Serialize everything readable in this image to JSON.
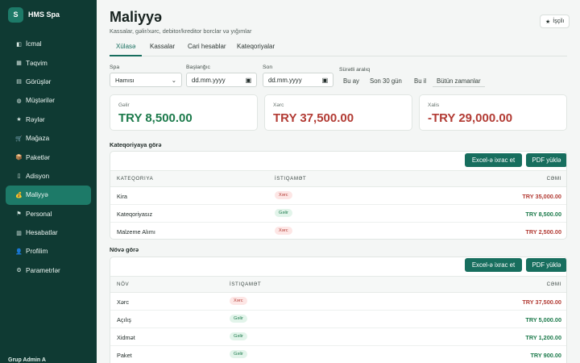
{
  "app": {
    "logo_letter": "S",
    "name": "HMS Spa"
  },
  "sidebar": {
    "items": [
      {
        "label": "İcmal",
        "icon": "dashboard-icon",
        "glyph": "◧"
      },
      {
        "label": "Təqvim",
        "icon": "calendar-icon",
        "glyph": "▦"
      },
      {
        "label": "Görüşlər",
        "icon": "appointments-icon",
        "glyph": "▤"
      },
      {
        "label": "Müştərilər",
        "icon": "clients-icon",
        "glyph": "◍"
      },
      {
        "label": "Rəylər",
        "icon": "star-icon",
        "glyph": "★"
      },
      {
        "label": "Mağaza",
        "icon": "shop-icon",
        "glyph": "🛒"
      },
      {
        "label": "Paketlər",
        "icon": "package-icon",
        "glyph": "📦"
      },
      {
        "label": "Adisyon",
        "icon": "receipt-icon",
        "glyph": "▯"
      },
      {
        "label": "Maliyyə",
        "icon": "finance-icon",
        "glyph": "💰"
      },
      {
        "label": "Personal",
        "icon": "flag-icon",
        "glyph": "⚑"
      },
      {
        "label": "Hesabatlar",
        "icon": "reports-icon",
        "glyph": "▥"
      },
      {
        "label": "Profilim",
        "icon": "profile-icon",
        "glyph": "👤"
      },
      {
        "label": "Parametrlər",
        "icon": "settings-icon",
        "glyph": "⚙"
      }
    ],
    "active_index": 8,
    "footer_user": "Grup Admin A"
  },
  "header": {
    "title": "Maliyyə",
    "subtitle": "Kassalar, gəlir/xərc, debitor/kreditor borclar və yığımlar",
    "role_badge": "İşçilı",
    "role_icon": "★"
  },
  "tabs": [
    "Xülasə",
    "Kassalar",
    "Cari hesablar",
    "Kateqoriyalar"
  ],
  "filters": {
    "spa_label": "Spa",
    "spa_value": "Hamısı",
    "start_label": "Başlanğıc",
    "start_value": "dd.mm.yyyy",
    "end_label": "Son",
    "end_value": "dd.mm.yyyy",
    "quick_label": "Sürətli aralıq",
    "quick_options": [
      "Bu ay",
      "Son 30 gün",
      "Bu il",
      "Bütün zamanlar"
    ]
  },
  "summary": {
    "income": {
      "label": "Gəlir",
      "value": "TRY 8,500.00",
      "color": "#1c7a4b"
    },
    "expense": {
      "label": "Xərc",
      "value": "TRY 37,500.00",
      "color": "#b23b34"
    },
    "net": {
      "label": "Xalis",
      "value": "-TRY 29,000.00",
      "color": "#b23b34"
    }
  },
  "by_category": {
    "title": "Kateqoriyaya görə",
    "export_excel": "Excel-ə ixrac et",
    "export_pdf": "PDF yüklə",
    "columns": [
      "Kateqoriya",
      "İstiqamət",
      "Cəmi"
    ],
    "rows": [
      {
        "name": "Kira",
        "direction": "Xərc",
        "type": "out",
        "total": "TRY 35,000.00"
      },
      {
        "name": "Kateqoriyasız",
        "direction": "Gəlir",
        "type": "in",
        "total": "TRY 8,500.00"
      },
      {
        "name": "Malzeme Alımı",
        "direction": "Xərc",
        "type": "out",
        "total": "TRY 2,500.00"
      }
    ]
  },
  "by_type": {
    "title": "Növə görə",
    "export_excel": "Excel-ə ixrac et",
    "export_pdf": "PDF yüklə",
    "columns": [
      "Növ",
      "İstiqamət",
      "Cəmi"
    ],
    "rows": [
      {
        "name": "Xərc",
        "direction": "Xərc",
        "type": "out",
        "total": "TRY 37,500.00"
      },
      {
        "name": "Açılış",
        "direction": "Gəlir",
        "type": "in",
        "total": "TRY 5,000.00"
      },
      {
        "name": "Xidmət",
        "direction": "Gəlir",
        "type": "in",
        "total": "TRY 1,200.00"
      },
      {
        "name": "Paket",
        "direction": "Gəlir",
        "type": "in",
        "total": "TRY 900.00"
      }
    ]
  }
}
